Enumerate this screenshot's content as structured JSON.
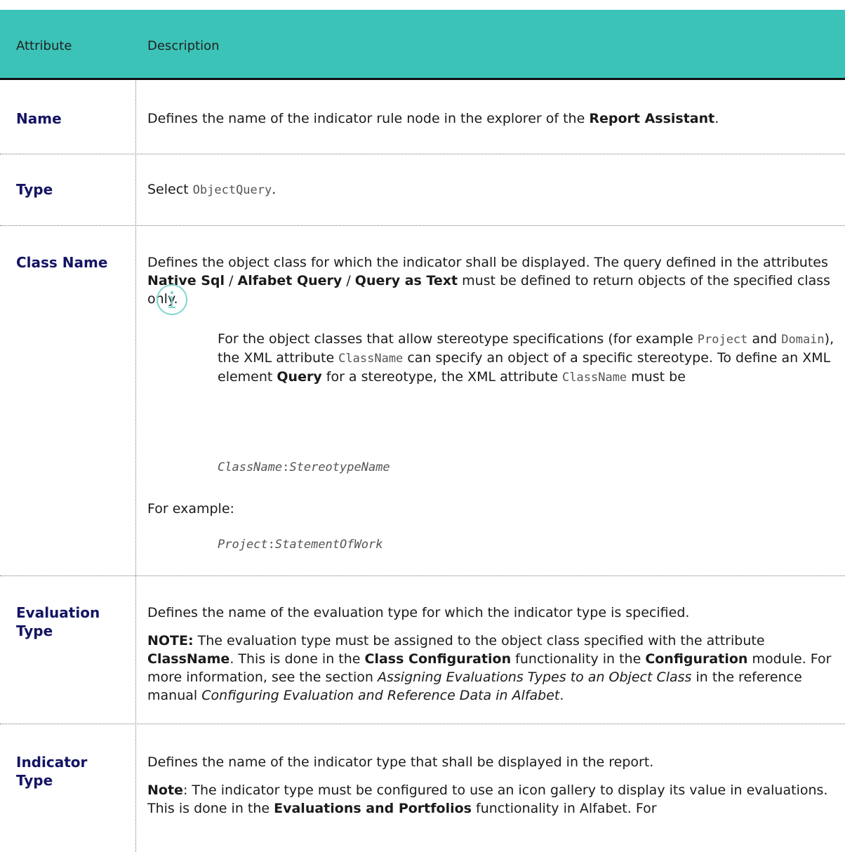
{
  "header": {
    "col_attribute": "Attribute",
    "col_description": "Description"
  },
  "rows": {
    "name": {
      "label": "Name",
      "pre": "Defines the name of the indicator rule node in the explorer of the ",
      "bold": "Report Assistant",
      "post": "."
    },
    "type": {
      "label": "Type",
      "pre": "Select ",
      "code": "ObjectQuery",
      "post": "."
    },
    "class_name": {
      "label": "Class Name",
      "p1_a": "Defines the object class for which the indicator shall be displayed. The query defined in the attributes ",
      "p1_b1": "Native Sql",
      "p1_sep1": " / ",
      "p1_b2": "Alfabet Query",
      "p1_sep2": " / ",
      "p1_b3": "Query as Text",
      "p1_c": " must be defined to return objects of the specified class only.",
      "note": {
        "icon": "info-icon",
        "t1": "For the object classes that allow stereotype specifications (for example ",
        "c1": "Project",
        "t2": " and ",
        "c2": "Domain",
        "t3": "), the XML attribute ",
        "c3": "ClassName",
        "t4": " can specify an object of a specific stereotype. To define an XML element ",
        "b1": "Query",
        "t5": " for a stereotype, the XML attribute ",
        "c4": "ClassName",
        "t6": " must be"
      },
      "code1_a": "ClassName",
      "code1_sep": ":",
      "code1_b": "StereotypeName",
      "example_label": "For example:",
      "code2_a": "Project",
      "code2_sep": ":",
      "code2_b": "StatementOfWork"
    },
    "evaluation_type": {
      "label": "Evaluation Type",
      "p1": "Defines the name of the evaluation type for which the indicator type is specified.",
      "note_label": "NOTE:",
      "n1": " The evaluation type must be assigned to the object class specified with the attribute ",
      "nb1": "ClassName",
      "n2": ". This is done in the ",
      "nb2": "Class Configuration",
      "n3": " functionality in the ",
      "nb3": "Configuration",
      "n4": " module. For more information, see the section ",
      "ni1": "Assigning Evaluations Types to an Object Class",
      "n5": " in the reference manual ",
      "ni2": "Configuring Evaluation and Reference Data in Alfabet",
      "n6": "."
    },
    "indicator_type": {
      "label": "Indicator Type",
      "p1": "Defines the name of the indicator type that shall be displayed in the report.",
      "note_label": "Note",
      "n1": ": The indicator type must be configured to use an icon gallery to display its value in evaluations. This is done in the ",
      "nb1": "Evaluations and Portfolios",
      "n2": " functionality in Alfabet. For"
    }
  },
  "colors": {
    "header_bg": "#3cc3b8",
    "attr_text": "#141464",
    "note_icon": "#7fd6cf"
  }
}
